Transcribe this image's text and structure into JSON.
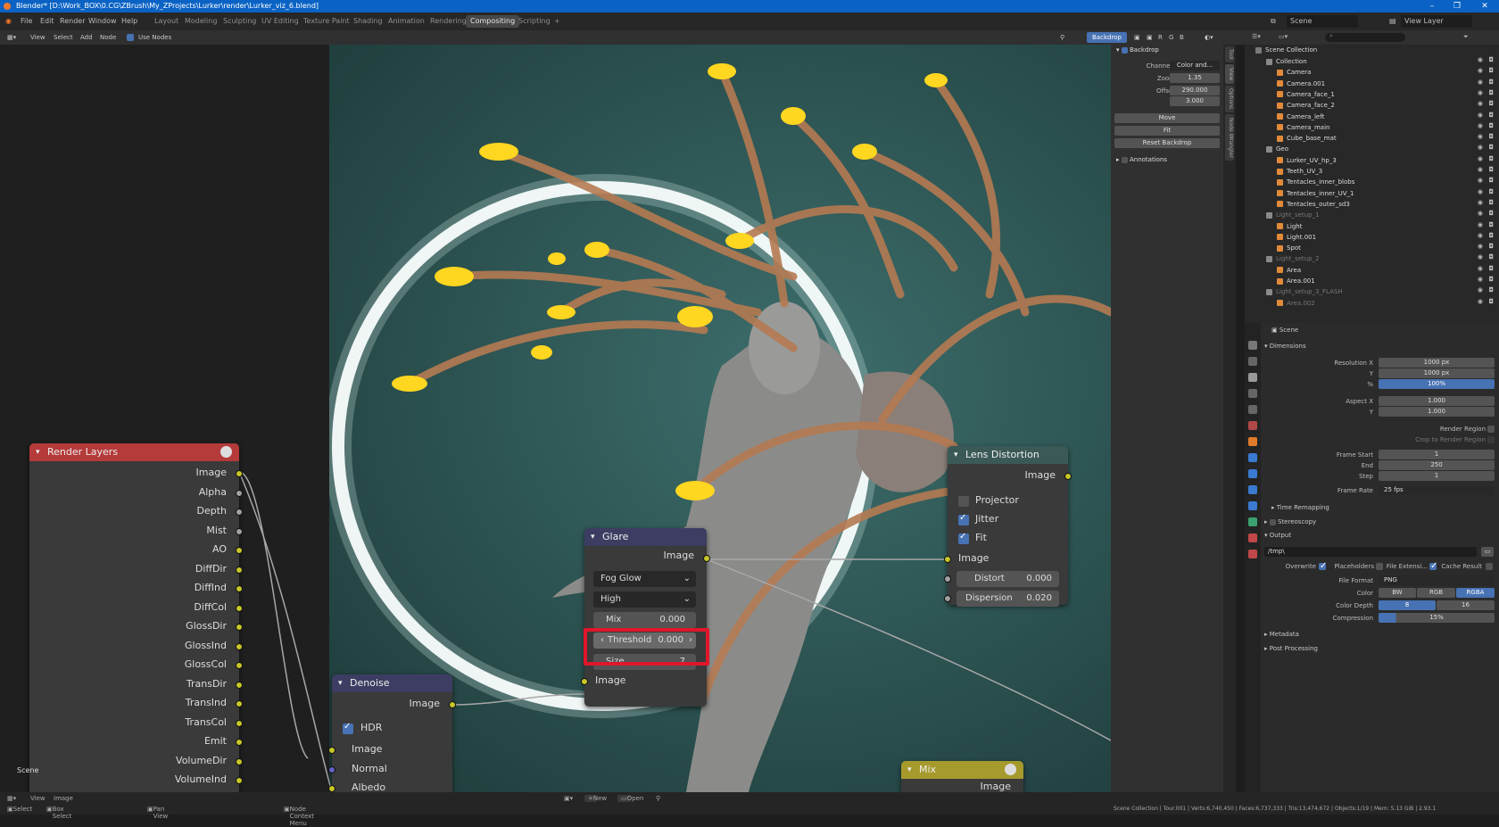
{
  "window": {
    "title": "Blender* [D:\\Work_BOX\\0.CG\\ZBrush\\My_ZProjects\\Lurker\\render\\Lurker_viz_6.blend]",
    "controls": [
      "–",
      "❐",
      "✕"
    ]
  },
  "menu": [
    "File",
    "Edit",
    "Render",
    "Window",
    "Help"
  ],
  "workspaces": [
    "Layout",
    "Modeling",
    "Sculpting",
    "UV Editing",
    "Texture Paint",
    "Shading",
    "Animation",
    "Rendering",
    "Compositing",
    "Scripting",
    "+"
  ],
  "active_workspace": "Compositing",
  "scene_field": "Scene",
  "view_layer_field": "View Layer",
  "node_header": {
    "menus": [
      "View",
      "Select",
      "Add",
      "Node"
    ],
    "use_nodes": "Use Nodes",
    "backdrop_btn": "Backdrop",
    "channel_btns": [
      "R",
      "G",
      "B"
    ]
  },
  "nodes": {
    "render_layers": {
      "title": "Render Layers",
      "outputs": [
        "Image",
        "Alpha",
        "Depth",
        "Mist",
        "AO",
        "DiffDir",
        "DiffInd",
        "DiffCol",
        "GlossDir",
        "GlossInd",
        "GlossCol",
        "TransDir",
        "TransInd",
        "TransCol",
        "Emit",
        "VolumeDir",
        "VolumeInd"
      ],
      "scene_label": "Scene"
    },
    "denoise": {
      "title": "Denoise",
      "output": "Image",
      "hdr": "HDR",
      "inputs": [
        "Image",
        "Normal",
        "Albedo"
      ]
    },
    "glare": {
      "title": "Glare",
      "output": "Image",
      "type": "Fog Glow",
      "quality": "High",
      "mix_label": "Mix",
      "mix_value": "0.000",
      "threshold_label": "Threshold",
      "threshold_value": "0.000",
      "size_label": "Size",
      "size_value": "7",
      "input": "Image"
    },
    "lens_distortion": {
      "title": "Lens Distortion",
      "output": "Image",
      "projector": "Projector",
      "jitter": "Jitter",
      "fit": "Fit",
      "input": "Image",
      "distort_label": "Distort",
      "distort_value": "0.000",
      "dispersion_label": "Dispersion",
      "dispersion_value": "0.020"
    },
    "mix": {
      "title": "Mix",
      "output": "Image"
    }
  },
  "sidebar": {
    "section": "Backdrop",
    "channels_label": "Channels",
    "channels_value": "Color and...",
    "zoom_label": "Zoom",
    "zoom_value": "1.35",
    "offset_label": "Offset",
    "offset_x": "290.000",
    "offset_y": "3.000",
    "move": "Move",
    "fit": "Fit",
    "reset": "Reset Backdrop",
    "annotations": "Annotations",
    "tabs": [
      "Tool",
      "View",
      "Options",
      "Node Wrangler"
    ]
  },
  "outliner": {
    "root": "Scene Collection",
    "items": [
      {
        "name": "Collection",
        "indent": 1,
        "type": "coll"
      },
      {
        "name": "Camera",
        "indent": 2,
        "type": "cam"
      },
      {
        "name": "Camera.001",
        "indent": 2,
        "type": "cam"
      },
      {
        "name": "Camera_face_1",
        "indent": 2,
        "type": "cam"
      },
      {
        "name": "Camera_face_2",
        "indent": 2,
        "type": "cam"
      },
      {
        "name": "Camera_left",
        "indent": 2,
        "type": "cam"
      },
      {
        "name": "Camera_main",
        "indent": 2,
        "type": "cam"
      },
      {
        "name": "Cube_base_mat",
        "indent": 2,
        "type": "mesh"
      },
      {
        "name": "Geo",
        "indent": 1,
        "type": "coll"
      },
      {
        "name": "Lurker_UV_hp_3",
        "indent": 2,
        "type": "mesh"
      },
      {
        "name": "Teeth_UV_3",
        "indent": 2,
        "type": "mesh"
      },
      {
        "name": "Tentacles_inner_blobs",
        "indent": 2,
        "type": "mesh"
      },
      {
        "name": "Tentacles_inner_UV_1",
        "indent": 2,
        "type": "mesh"
      },
      {
        "name": "Tentacles_outer_sd3",
        "indent": 2,
        "type": "mesh"
      },
      {
        "name": "Light_setup_1",
        "indent": 1,
        "type": "coll",
        "dim": true
      },
      {
        "name": "Light",
        "indent": 2,
        "type": "light"
      },
      {
        "name": "Light.001",
        "indent": 2,
        "type": "light"
      },
      {
        "name": "Spot",
        "indent": 2,
        "type": "light"
      },
      {
        "name": "Light_setup_2",
        "indent": 1,
        "type": "coll",
        "dim": true
      },
      {
        "name": "Area",
        "indent": 2,
        "type": "light"
      },
      {
        "name": "Area.001",
        "indent": 2,
        "type": "light"
      },
      {
        "name": "Light_setup_3_FLASH",
        "indent": 1,
        "type": "coll",
        "dim": true
      },
      {
        "name": "Area.002",
        "indent": 2,
        "type": "light",
        "dim": true
      }
    ]
  },
  "properties": {
    "header": "Scene",
    "dimensions": "Dimensions",
    "res_x_label": "Resolution X",
    "res_x": "1000 px",
    "res_y_label": "Y",
    "res_y": "1000 px",
    "pct_label": "%",
    "pct": "100%",
    "aspect_x_label": "Aspect X",
    "aspect_x": "1.000",
    "aspect_y_label": "Y",
    "aspect_y": "1.000",
    "render_region": "Render Region",
    "crop": "Crop to Render Region",
    "frame_start_label": "Frame Start",
    "frame_start": "1",
    "end_label": "End",
    "end": "250",
    "step_label": "Step",
    "step": "1",
    "frame_rate_label": "Frame Rate",
    "frame_rate": "25 fps",
    "time_remapping": "Time Remapping",
    "stereoscopy": "Stereoscopy",
    "output": "Output",
    "path": "/tmp\\",
    "overwrite": "Overwrite",
    "placeholders": "Placeholders",
    "file_ext": "File Extensi...",
    "cache": "Cache Result",
    "file_format_label": "File Format",
    "file_format": "PNG",
    "color_label": "Color",
    "color_opts": [
      "BW",
      "RGB",
      "RGBA"
    ],
    "color_depth_label": "Color Depth",
    "depth_opts": [
      "8",
      "16"
    ],
    "compression_label": "Compression",
    "compression": "15%",
    "metadata": "Metadata",
    "post": "Post Processing"
  },
  "footer": {
    "menus": [
      "View",
      "Image"
    ],
    "new": "New",
    "open": "Open"
  },
  "statusbar": {
    "select": "Select",
    "box_select": "Box Select",
    "pan_view": "Pan View",
    "context_menu": "Node Context Menu",
    "stats": "Scene Collection | Tour.001 | Verts:6,740,450 | Faces:6,737,333 | Tris:13,474,672 | Objects:1/19 | Mem: 5.13 GiB | 2.93.1"
  },
  "colors": {
    "accent": "#4772b3",
    "render_layers_header": "#b53a3a",
    "denoise_header": "#3d3d63",
    "glare_header": "#3d3d63",
    "lens_header": "#3b5a57",
    "mix_header": "#a69a2d",
    "highlight": "#e0162b"
  }
}
